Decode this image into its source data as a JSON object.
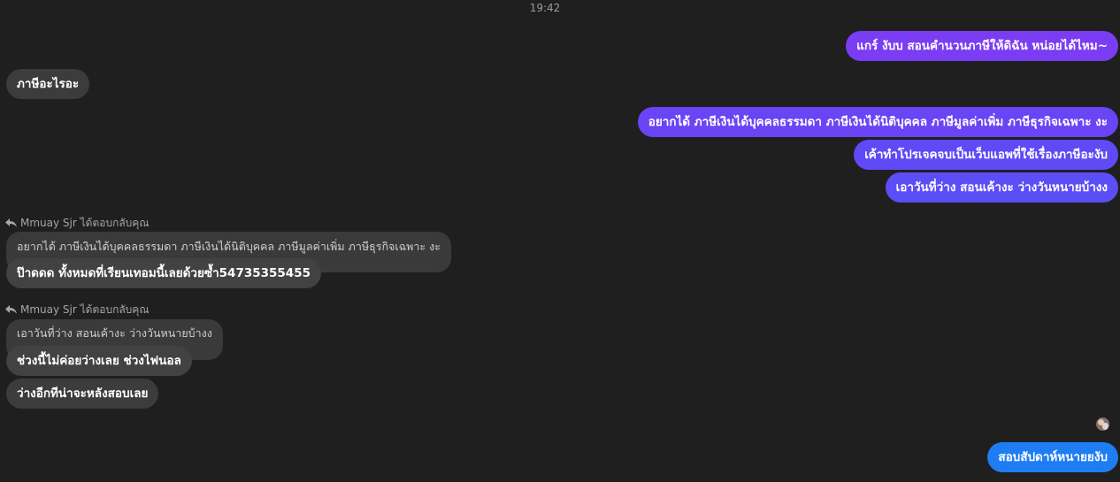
{
  "timestamp": "19:42",
  "messages": {
    "m1": "แกร์ งับบ สอนคำนวนภาษีให้ดิฉัน หน่อยได้ไหม~",
    "m2": "ภาษีอะไรอะ",
    "m3": "อยากได้ ภาษีเงินได้บุคคลธรรมดา ภาษีเงินได้นิติบุคคล ภาษีมูลค่าเพิ่ม ภาษีธุรกิจเฉพาะ งะ",
    "m4": "เค้าทำโปรเจคจบเป็นเว็บแอพที่ใช้เรื่องภาษีอะงับ",
    "m5": "เอาวันที่ว่าง สอนเค้างะ ว่างวันหนายบ้างง",
    "reply1_header": "Mmuay Sjr ได้ตอบกลับคุณ",
    "reply1_quote": "อยากได้ ภาษีเงินได้บุคคลธรรมดา ภาษีเงินได้นิติบุคคล ภาษีมูลค่าเพิ่ม ภาษีธุรกิจเฉพาะ งะ",
    "m6": "ป๊าดดด ทั้งหมดที่เรียนเทอมนี้เลยด้วยซ้ำ54735355455",
    "reply2_header": "Mmuay Sjr ได้ตอบกลับคุณ",
    "reply2_quote": "เอาวันที่ว่าง สอนเค้างะ ว่างวันหนายบ้างง",
    "m7": "ช่วงนี้ไม่ค่อยว่างเลย ช่วงไฟนอล",
    "m8": "ว่างอีกทีน่าจะหลังสอบเลย",
    "m9": "สอบสัปดาห์หนายยงับ"
  },
  "colors": {
    "background": "#1f1f1f",
    "incoming_bubble": "#3c3c3c",
    "out_purple": "#7a3df3",
    "out_indigo": "#5b4ef6",
    "out_blue": "#1e7df2"
  }
}
